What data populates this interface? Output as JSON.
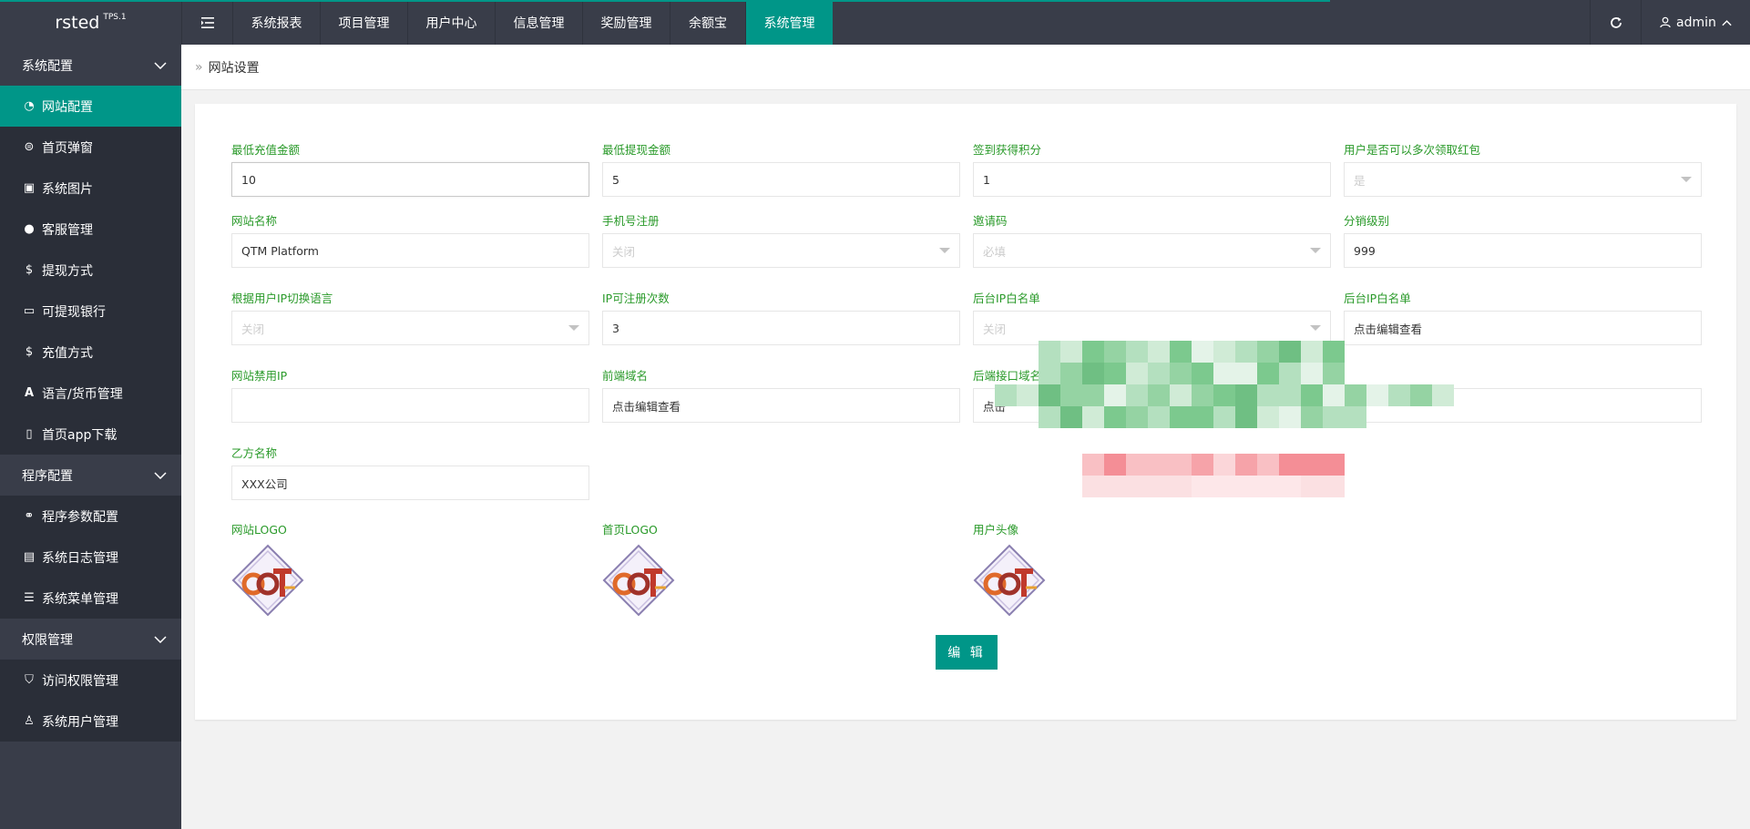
{
  "app": {
    "name": "rsted",
    "version": "TPS.1"
  },
  "topnav": {
    "toggle_icon": "menu-fold-icon",
    "items": [
      {
        "label": "系统报表",
        "active": false
      },
      {
        "label": "项目管理",
        "active": false
      },
      {
        "label": "用户中心",
        "active": false
      },
      {
        "label": "信息管理",
        "active": false
      },
      {
        "label": "奖励管理",
        "active": false
      },
      {
        "label": "余额宝",
        "active": false
      },
      {
        "label": "系统管理",
        "active": true
      }
    ],
    "refresh_icon": "refresh-icon",
    "user": "admin"
  },
  "sidebar": {
    "groups": [
      {
        "label": "系统配置",
        "items": [
          {
            "label": "网站配置",
            "icon": "dashboard-icon",
            "active": true
          },
          {
            "label": "首页弹窗",
            "icon": "popup-icon",
            "active": false
          },
          {
            "label": "系统图片",
            "icon": "image-icon",
            "active": false
          },
          {
            "label": "客服管理",
            "icon": "chat-icon",
            "active": false
          },
          {
            "label": "提现方式",
            "icon": "dollar-icon",
            "active": false
          },
          {
            "label": "可提现银行",
            "icon": "card-icon",
            "active": false
          },
          {
            "label": "充值方式",
            "icon": "dollar-icon",
            "active": false
          },
          {
            "label": "语言/货币管理",
            "icon": "font-icon",
            "active": false
          },
          {
            "label": "首页app下载",
            "icon": "mobile-icon",
            "active": false
          }
        ]
      },
      {
        "label": "程序配置",
        "items": [
          {
            "label": "程序参数配置",
            "icon": "link-icon",
            "active": false
          },
          {
            "label": "系统日志管理",
            "icon": "log-icon",
            "active": false
          },
          {
            "label": "系统菜单管理",
            "icon": "menu-icon",
            "active": false
          }
        ]
      },
      {
        "label": "权限管理",
        "items": [
          {
            "label": "访问权限管理",
            "icon": "shield-icon",
            "active": false
          },
          {
            "label": "系统用户管理",
            "icon": "user-icon",
            "active": false
          }
        ]
      }
    ]
  },
  "breadcrumb": {
    "current": "网站设置"
  },
  "form": {
    "min_recharge": {
      "label": "最低充值金额",
      "value": "10"
    },
    "min_withdraw": {
      "label": "最低提现金额",
      "value": "5"
    },
    "signin_points": {
      "label": "签到获得积分",
      "value": "1"
    },
    "multi_redpack": {
      "label": "用户是否可以多次领取红包",
      "value": "是"
    },
    "site_name": {
      "label": "网站名称",
      "value": "QTM Platform"
    },
    "phone_register": {
      "label": "手机号注册",
      "value": "关闭"
    },
    "invite_code": {
      "label": "邀请码",
      "value": "必填"
    },
    "distribution_level": {
      "label": "分销级别",
      "value": "999"
    },
    "ip_language": {
      "label": "根据用户IP切换语言",
      "value": "关闭"
    },
    "ip_register_count": {
      "label": "IP可注册次数",
      "value": "3"
    },
    "admin_ip_whitelist_switch": {
      "label": "后台IP白名单",
      "value": "关闭"
    },
    "admin_ip_whitelist": {
      "label": "后台IP白名单",
      "value": "点击编辑查看"
    },
    "banned_ip": {
      "label": "网站禁用IP",
      "value": ""
    },
    "frontend_domain": {
      "label": "前端域名",
      "value": "点击编辑查看"
    },
    "backend_domain": {
      "label": "后端接口域名",
      "value": "点击"
    },
    "party_b_name": {
      "label": "乙方名称",
      "value": "XXX公司"
    },
    "site_logo": {
      "label": "网站LOGO"
    },
    "home_logo": {
      "label": "首页LOGO"
    },
    "user_avatar": {
      "label": "用户头像"
    },
    "edit_button": "编 辑"
  },
  "colors": {
    "accent": "#009688",
    "sidebar_bg": "#393d49",
    "label_green": "#2a9a2a"
  }
}
